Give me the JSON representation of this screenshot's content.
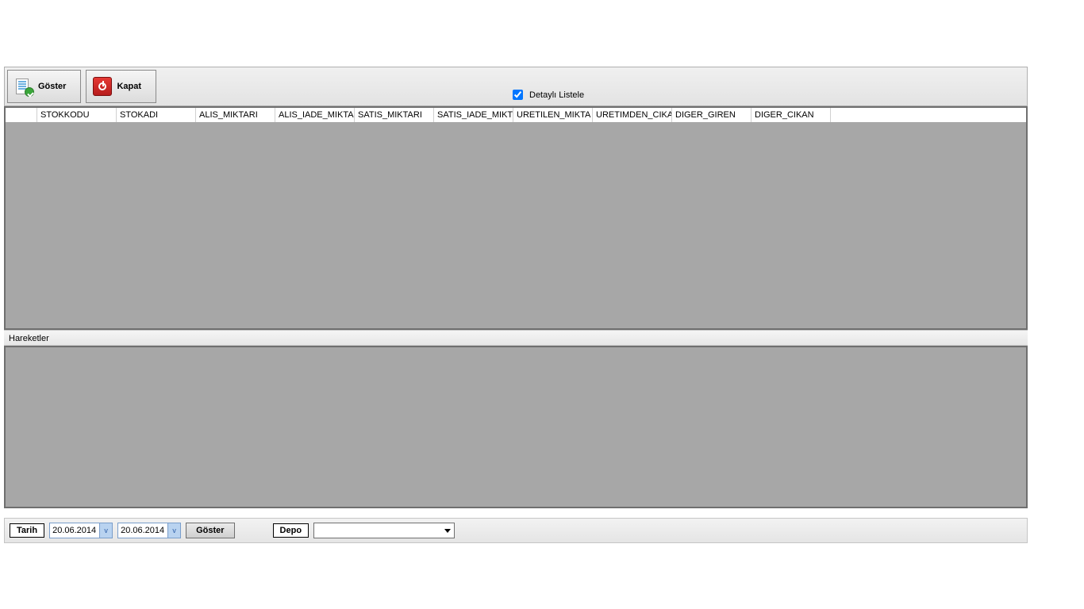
{
  "toolbar": {
    "goster_label": "Göster",
    "kapat_label": "Kapat",
    "detail_checkbox_label": "Detaylı Listele",
    "detail_checkbox_checked": true
  },
  "grid": {
    "columns": [
      "STOKKODU",
      "STOKADI",
      "ALIS_MIKTARI",
      "ALIS_IADE_MIKTA",
      "SATIS_MIKTARI",
      "SATIS_IADE_MIKT",
      "URETILEN_MIKTA",
      "URETIMDEN_CIKA",
      "DIGER_GIREN",
      "DIGER_CIKAN"
    ],
    "rows": []
  },
  "section": {
    "hareketler_label": "Hareketler"
  },
  "footer": {
    "tarih_label": "Tarih",
    "date_from": "20.06.2014",
    "date_to": "20.06.2014",
    "goster_label": "Göster",
    "depo_label": "Depo",
    "depo_value": ""
  }
}
